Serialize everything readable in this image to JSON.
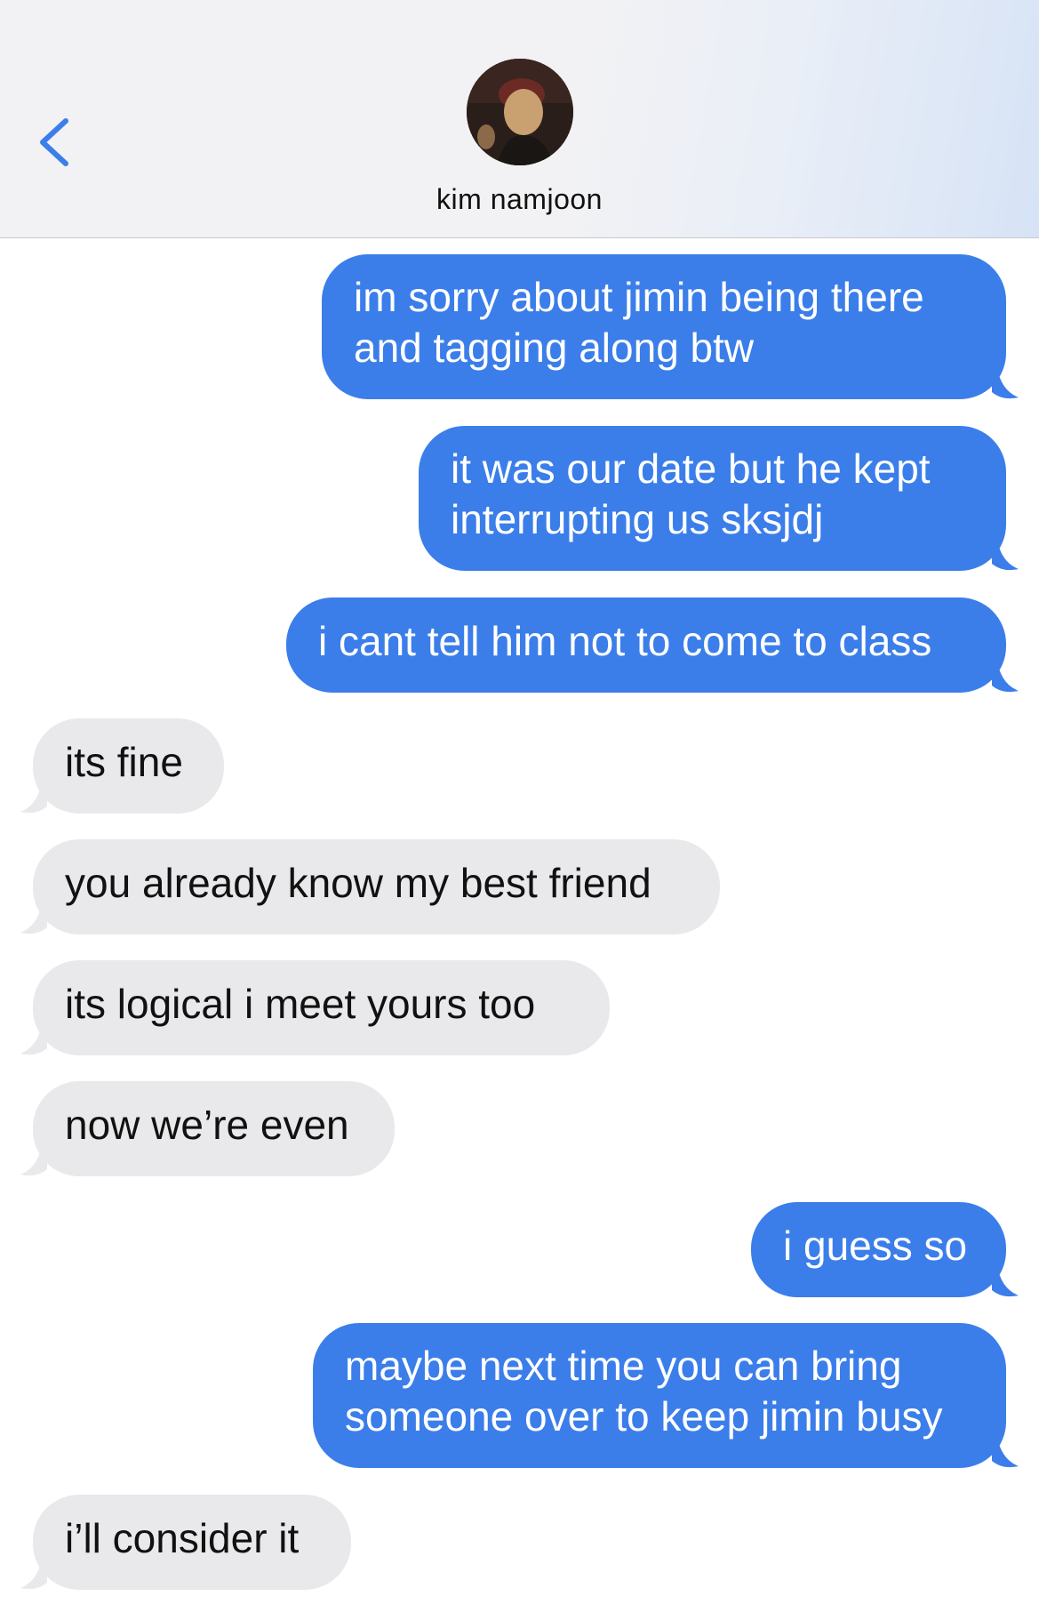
{
  "header": {
    "contact_name": "kim namjoon",
    "back_icon": "chevron-left-icon",
    "accent_color": "#3b7eea"
  },
  "messages": [
    {
      "side": "out",
      "lines": [
        "im sorry about jimin being there",
        "and tagging along btw"
      ]
    },
    {
      "side": "out",
      "lines": [
        "it was our date but he kept",
        "interrupting us sksjdj"
      ]
    },
    {
      "side": "out",
      "lines": [
        "i cant tell him not to come to class"
      ]
    },
    {
      "side": "in",
      "lines": [
        "its fine"
      ]
    },
    {
      "side": "in",
      "lines": [
        "you already know my best friend"
      ]
    },
    {
      "side": "in",
      "lines": [
        "its logical i meet yours too"
      ]
    },
    {
      "side": "in",
      "lines": [
        "now we’re even"
      ]
    },
    {
      "side": "out",
      "lines": [
        "i guess so"
      ]
    },
    {
      "side": "out",
      "lines": [
        "maybe next time you can bring",
        "someone over to keep jimin busy"
      ]
    },
    {
      "side": "in",
      "lines": [
        "i’ll consider it"
      ]
    }
  ],
  "colors": {
    "outgoing_bubble": "#3b7eea",
    "incoming_bubble": "#e9e9eb"
  }
}
